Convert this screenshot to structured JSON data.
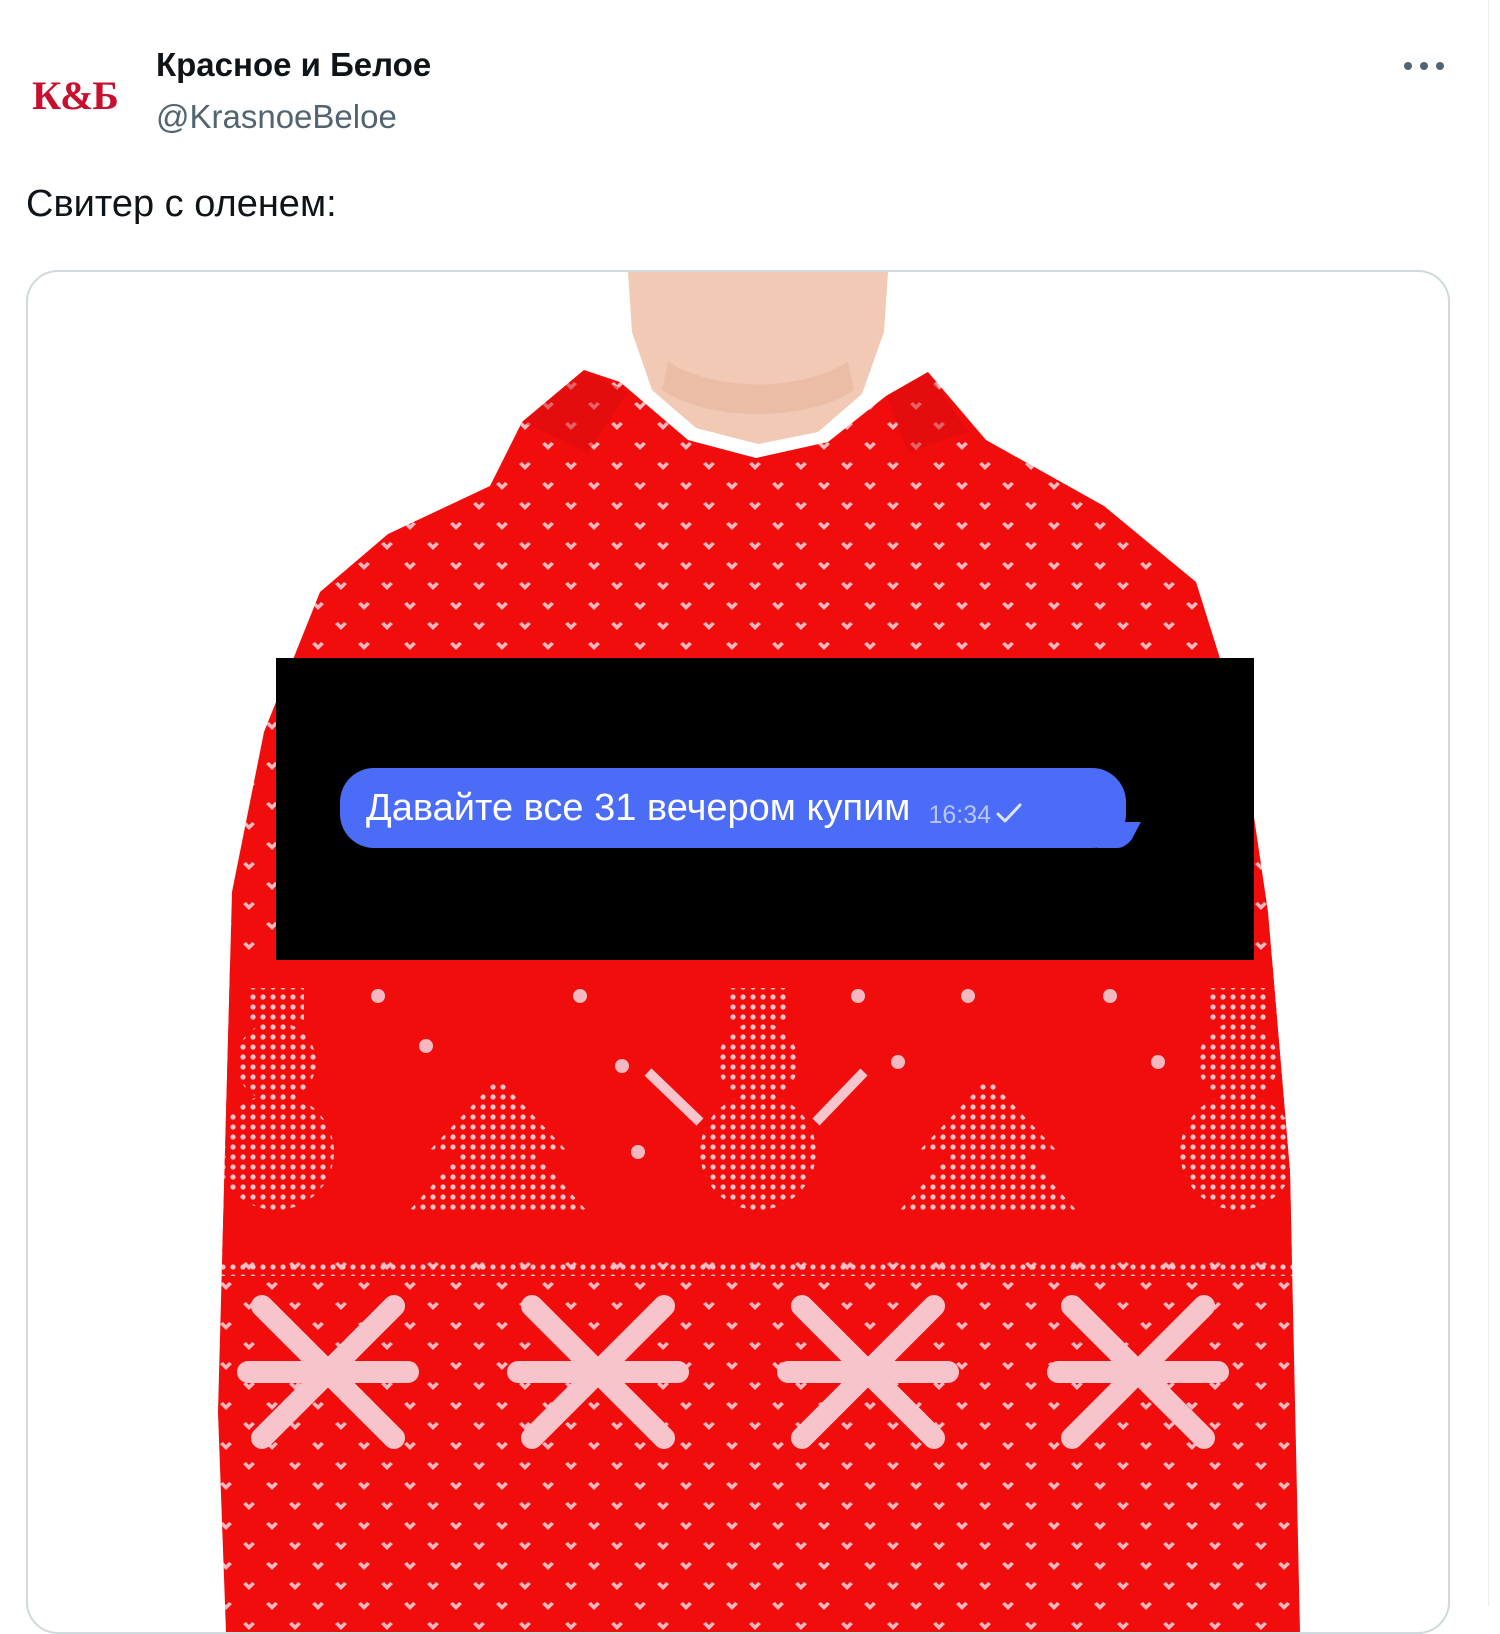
{
  "author": {
    "logo_text": "К&Б",
    "display_name": "Красное и Белое",
    "handle": "@KrasnoeBeloe"
  },
  "tweet": {
    "text": "Свитер с оленем:"
  },
  "media": {
    "image_icon": "knit-sweater-image",
    "message": {
      "text": "Давайте все 31 вечером купим",
      "time": "16:34",
      "status_icon": "check-icon"
    }
  },
  "colors": {
    "sweater_red": "#f20d0d",
    "knit_pattern": "#f4b8c0",
    "bubble_blue": "#4a6cf7"
  }
}
